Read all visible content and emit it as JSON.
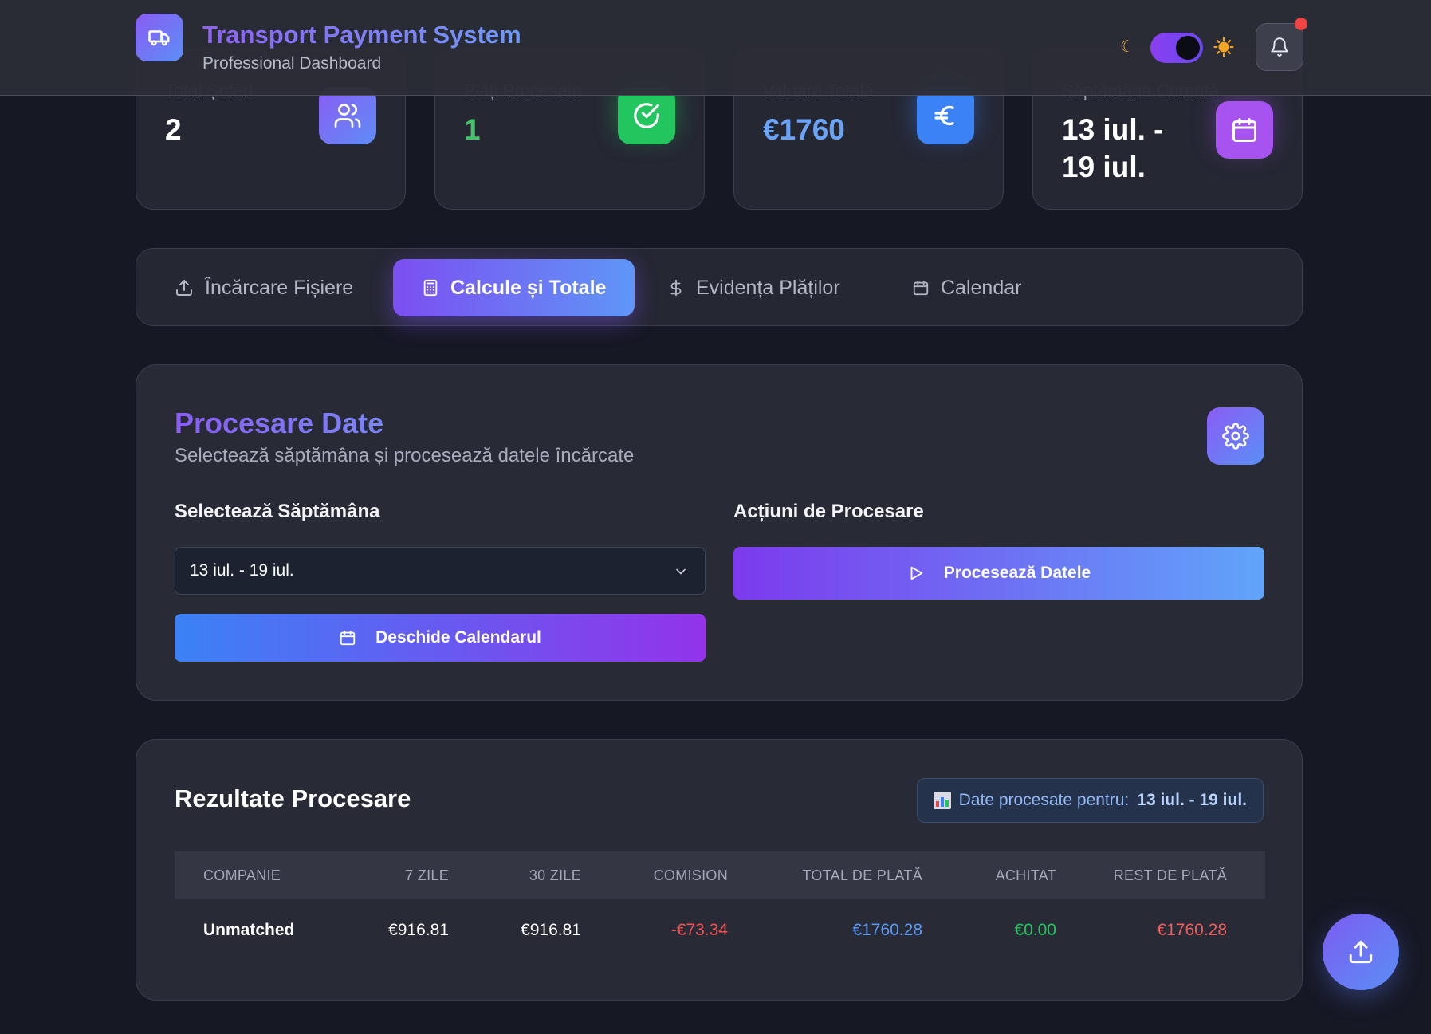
{
  "header": {
    "title": "Transport Payment System",
    "subtitle": "Professional Dashboard",
    "theme_toggle_on": true,
    "notification_dot": true
  },
  "stats": [
    {
      "label": "Total Șoferi",
      "value": "2",
      "icon": "users-icon"
    },
    {
      "label": "Plăți Procesate",
      "value": "1",
      "icon": "check-circle-icon"
    },
    {
      "label": "Valoare Totală",
      "value": "€1760",
      "icon": "euro-icon"
    },
    {
      "label": "Săptămâna Curentă",
      "value": "13 iul. - 19 iul.",
      "icon": "calendar-icon"
    }
  ],
  "tabs": [
    {
      "label": "Încărcare Fișiere",
      "icon": "upload-icon",
      "active": false
    },
    {
      "label": "Calcule și Totale",
      "icon": "calculator-icon",
      "active": true
    },
    {
      "label": "Evidența Plăților",
      "icon": "dollar-icon",
      "active": false
    },
    {
      "label": "Calendar",
      "icon": "calendar-icon",
      "active": false
    }
  ],
  "processing": {
    "title": "Procesare Date",
    "subtitle": "Selectează săptămâna și procesează datele încărcate",
    "week_heading": "Selectează Săptămâna",
    "actions_heading": "Acțiuni de Procesare",
    "selected_week": "13 iul. - 19 iul.",
    "open_calendar_label": "Deschide Calendarul",
    "process_label": "Procesează Datele"
  },
  "results": {
    "title": "Rezultate Procesare",
    "badge_prefix": "Date procesate pentru:",
    "badge_week": "13 iul. - 19 iul.",
    "columns": [
      "COMPANIE",
      "7 ZILE",
      "30 ZILE",
      "COMISION",
      "TOTAL DE PLATĂ",
      "ACHITAT",
      "REST DE PLATĂ"
    ],
    "rows": [
      [
        "Unmatched",
        "€916.81",
        "€916.81",
        "-€73.34",
        "€1760.28",
        "€0.00",
        "€1760.28"
      ]
    ]
  },
  "colors": {
    "accent_violet": "#7c4ff2",
    "accent_blue": "#5f96f6",
    "success": "#22c55e",
    "danger": "#f05252"
  }
}
